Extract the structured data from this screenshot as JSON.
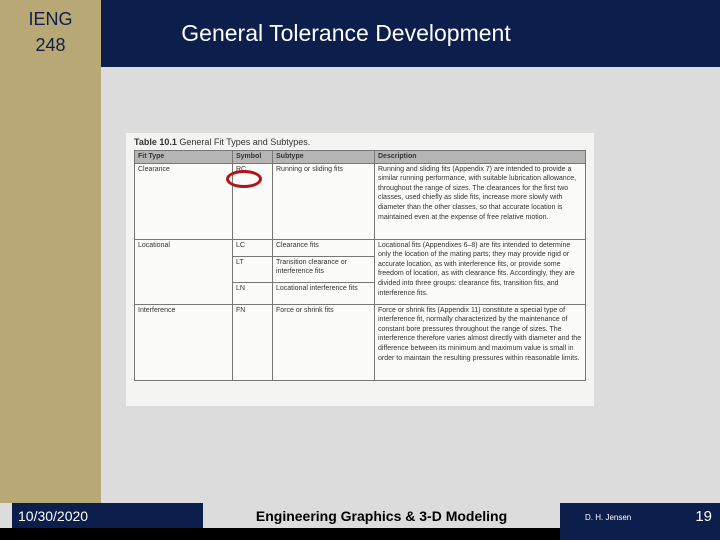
{
  "sidebar": {
    "course_line1": "IENG",
    "course_line2": "248"
  },
  "header": {
    "title": "General Tolerance Development"
  },
  "table": {
    "caption_bold": "Table 10.1",
    "caption": "General Fit Types and Subtypes.",
    "headers": [
      "Fit Type",
      "Symbol",
      "Subtype",
      "Description"
    ],
    "rows": [
      {
        "type": "Clearance",
        "symbol": "RC",
        "subtype": "Running or sliding fits",
        "desc": "Running and sliding fits (Appendix 7) are intended to provide a similar running performance, with suitable lubrication allowance, throughout the range of sizes. The clearances for the first two classes, used chiefly as slide fits, increase more slowly with diameter than the other classes, so that accurate location is maintained even at the expense of free relative motion."
      },
      {
        "type": "Locational",
        "symbol": "LC",
        "subtype": "Clearance fits",
        "desc": "Locational fits (Appendixes 6–8) are fits intended to determine only the location of the mating parts; they may provide rigid or accurate location, as with interference fits, or provide some freedom of location, as with clearance fits. Accordingly, they are divided into three groups: clearance fits, transition fits, and interference fits."
      },
      {
        "symbol": "LT",
        "subtype": "Transition clearance or interference fits"
      },
      {
        "symbol": "LN",
        "subtype": "Locational interference fits"
      },
      {
        "type": "Interference",
        "symbol": "FN",
        "subtype": "Force or shrink fits",
        "desc": "Force or shrink fits (Appendix 11) constitute a special type of interference fit, normally characterized by the maintenance of constant bore pressures throughout the range of sizes. The interference therefore varies almost directly with diameter and the difference between its minimum and maximum value is small in order to maintain the resulting pressures within reasonable limits."
      }
    ]
  },
  "footer": {
    "date": "10/30/2020",
    "course": "Engineering Graphics & 3-D Modeling",
    "author": "D. H. Jensen",
    "page": "19"
  }
}
